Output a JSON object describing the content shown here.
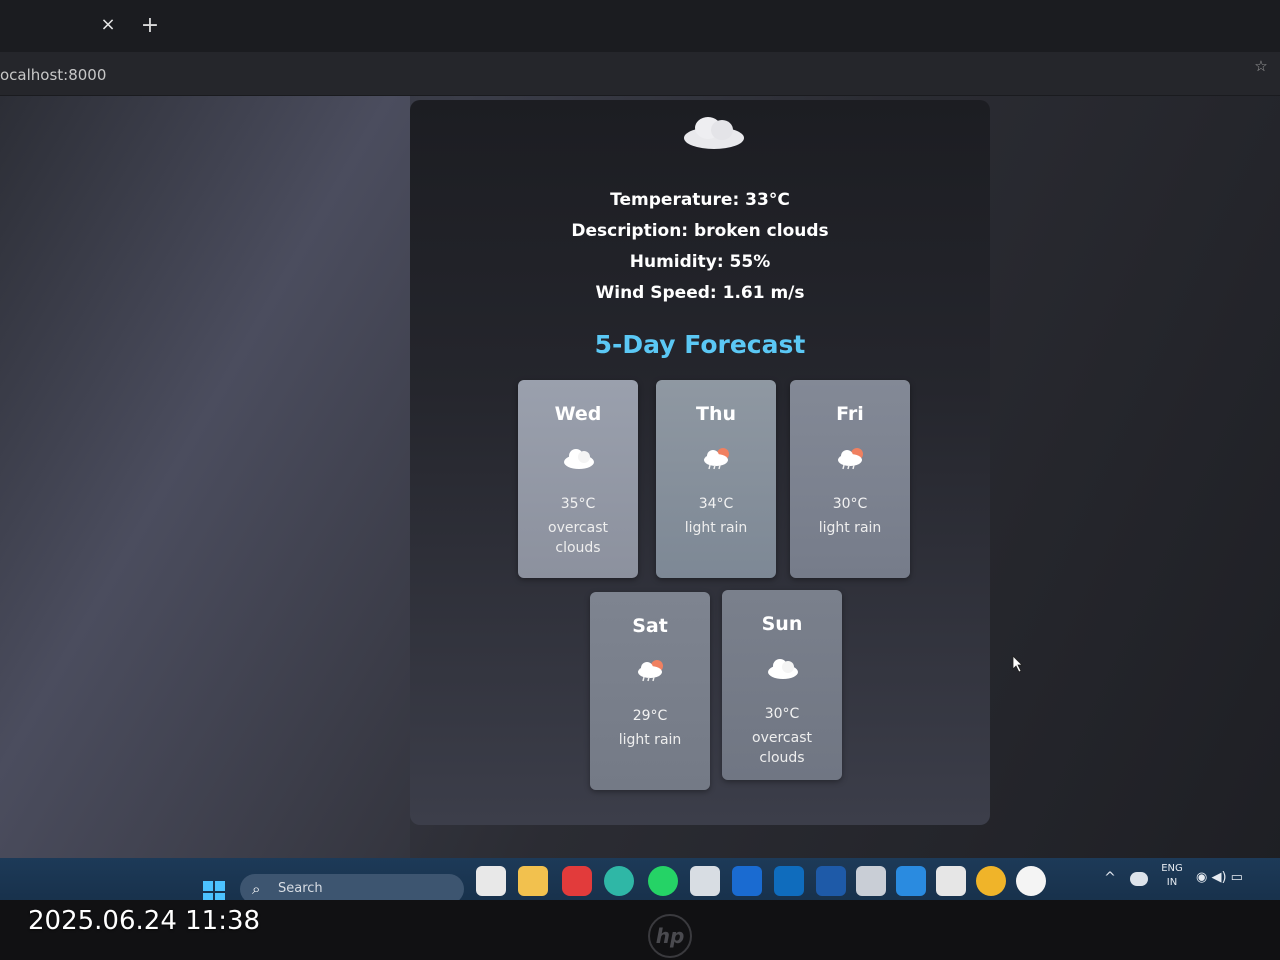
{
  "browser": {
    "tab_close": "×",
    "tab_new": "+",
    "url": "ocalhost:8000",
    "bookmark": "☆"
  },
  "current": {
    "icon": "cloud-icon",
    "temperature": "Temperature: 33°C",
    "description": "Description: broken clouds",
    "humidity": "Humidity: 55%",
    "wind": "Wind Speed: 1.61 m/s"
  },
  "forecast": {
    "title": "5-Day Forecast",
    "days": [
      {
        "day": "Wed",
        "temp": "35°C",
        "desc": "overcast clouds",
        "icon": "overcast-cloud-icon"
      },
      {
        "day": "Thu",
        "temp": "34°C",
        "desc": "light rain",
        "icon": "light-rain-icon"
      },
      {
        "day": "Fri",
        "temp": "30°C",
        "desc": "light rain",
        "icon": "light-rain-icon"
      },
      {
        "day": "Sat",
        "temp": "29°C",
        "desc": "light rain",
        "icon": "light-rain-icon"
      },
      {
        "day": "Sun",
        "temp": "30°C",
        "desc": "overcast clouds",
        "icon": "overcast-cloud-icon"
      }
    ]
  },
  "taskbar": {
    "search_placeholder": "Search",
    "search_icon": "⌕",
    "tray_up": "^",
    "lang_line1": "ENG",
    "lang_line2": "IN",
    "tray_symbols": "◉ ◀) ▭"
  },
  "photo": {
    "timestamp": "2025.06.24 11:38",
    "brand": "hp"
  },
  "colors": {
    "accent": "#5bc8f5",
    "card": "#9aa0ad",
    "taskbar": "#1d3a58"
  }
}
